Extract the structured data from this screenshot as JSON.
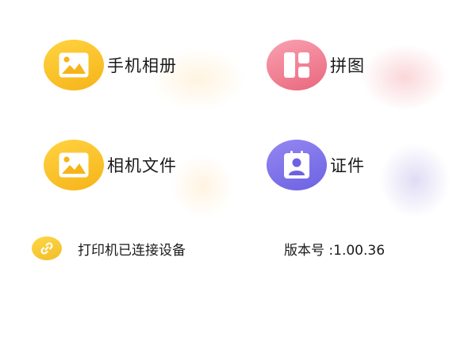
{
  "tiles": [
    {
      "label": "手机相册",
      "icon": "photo-icon",
      "color": "#f6b418"
    },
    {
      "label": "拼图",
      "icon": "collage-icon",
      "color": "#e9677c"
    },
    {
      "label": "相机文件",
      "icon": "photo-icon",
      "color": "#f6b418"
    },
    {
      "label": "证件",
      "icon": "id-photo-icon",
      "color": "#6d62e2"
    }
  ],
  "status": {
    "connection_text": "打印机已连接设备",
    "version_text": "版本号 :1.00.36",
    "icon": "link-icon"
  }
}
